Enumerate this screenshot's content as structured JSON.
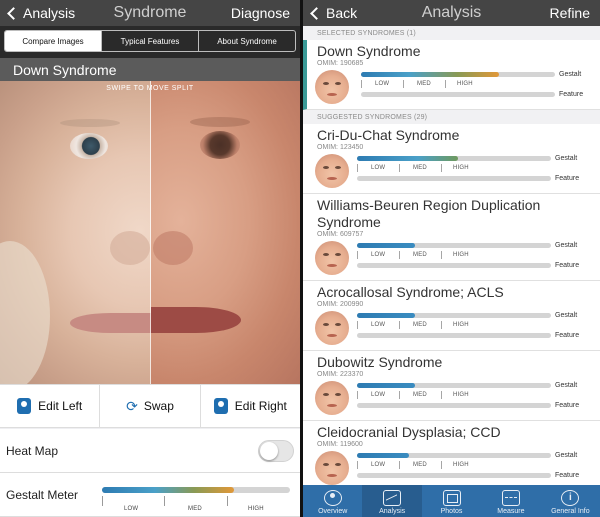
{
  "left": {
    "nav": {
      "back_label": "Analysis",
      "title": "Syndrome",
      "right_label": "Diagnose"
    },
    "segments": [
      "Compare Images",
      "Typical Features",
      "About Syndrome"
    ],
    "syndrome_name": "Down Syndrome",
    "swipe_hint": "SWIPE TO MOVE SPLIT",
    "actions": {
      "edit_left": "Edit Left",
      "swap": "Swap",
      "edit_right": "Edit Right"
    },
    "heat_map": {
      "label": "Heat Map",
      "enabled": false
    },
    "gestalt_meter": {
      "label": "Gestalt Meter",
      "value": 0.7,
      "levels": [
        "LOW",
        "MED",
        "HIGH"
      ]
    }
  },
  "right": {
    "nav": {
      "back_label": "Back",
      "title": "Analysis",
      "right_label": "Refine"
    },
    "selected_header": "SELECTED SYNDROMES (1)",
    "suggested_header": "SUGGESTED SYNDROMES (29)",
    "bar_labels": {
      "gestalt": "Gestalt",
      "feature": "Feature"
    },
    "levels": [
      "LOW",
      "MED",
      "HIGH"
    ],
    "selected": [
      {
        "name": "Down Syndrome",
        "omim": "OMIM: 190685",
        "gestalt": 0.71,
        "feature": 0.0
      }
    ],
    "suggested": [
      {
        "name": "Cri-Du-Chat Syndrome",
        "omim": "OMIM: 123450",
        "gestalt": 0.52,
        "feature": 0.0
      },
      {
        "name": "Williams-Beuren Region Duplication Syndrome",
        "omim": "OMIM: 609757",
        "gestalt": 0.3,
        "feature": 0.0
      },
      {
        "name": "Acrocallosal Syndrome; ACLS",
        "omim": "OMIM: 200990",
        "gestalt": 0.3,
        "feature": 0.0
      },
      {
        "name": "Dubowitz Syndrome",
        "omim": "OMIM: 223370",
        "gestalt": 0.3,
        "feature": 0.0
      },
      {
        "name": "Cleidocranial Dysplasia; CCD",
        "omim": "OMIM: 119600",
        "gestalt": 0.27,
        "feature": 0.0
      }
    ],
    "tabs": [
      {
        "label": "Overview",
        "icon": "person-circle-icon"
      },
      {
        "label": "Analysis",
        "icon": "chart-icon",
        "active": true
      },
      {
        "label": "Photos",
        "icon": "photos-icon"
      },
      {
        "label": "Measure",
        "icon": "ruler-icon"
      },
      {
        "label": "General Info",
        "icon": "info-icon"
      }
    ]
  }
}
